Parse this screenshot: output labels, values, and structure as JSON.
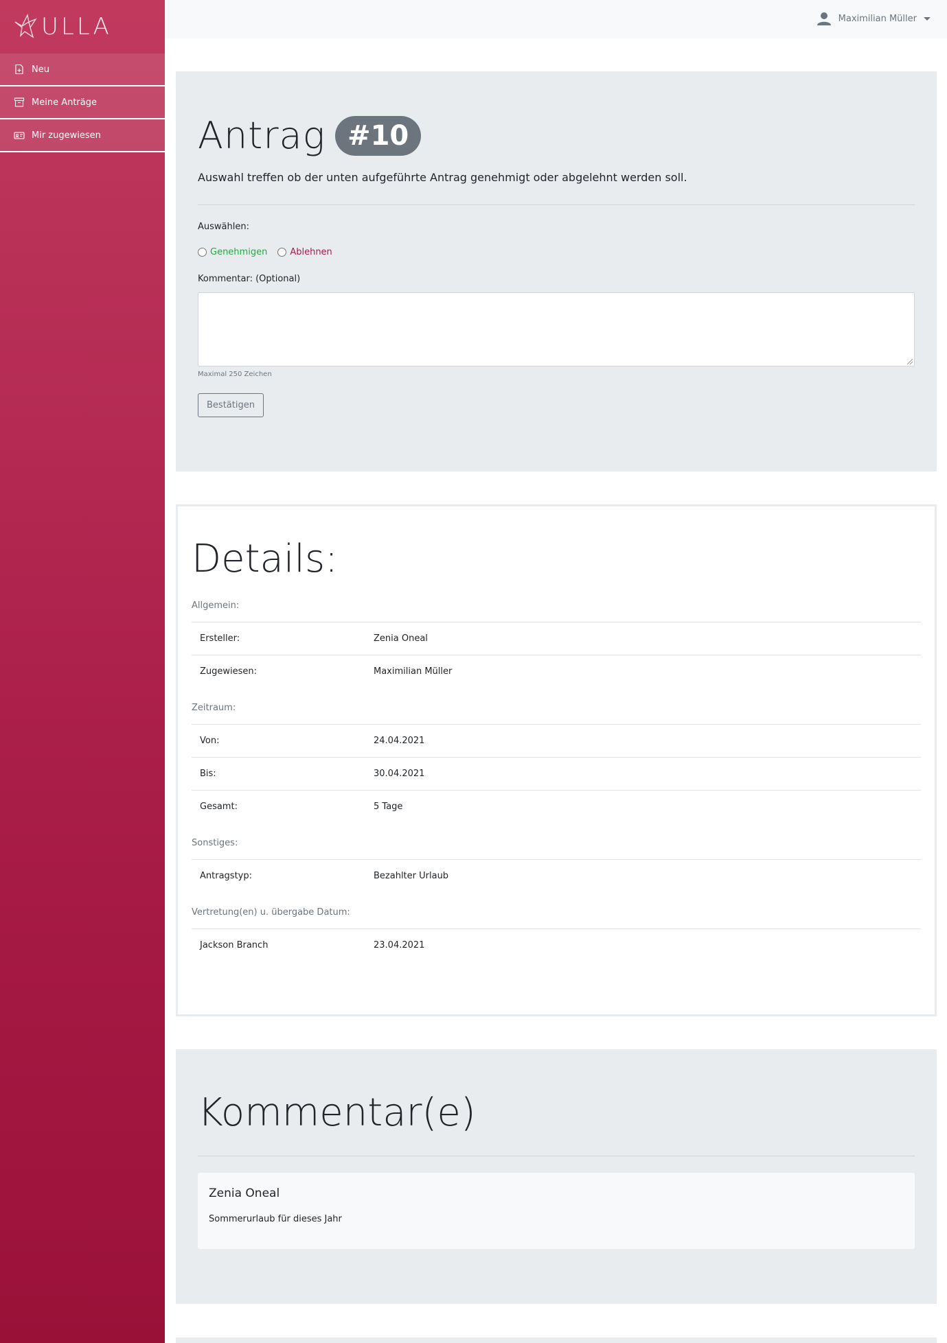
{
  "app": {
    "logo_text": "ULLA"
  },
  "sidebar": {
    "items": [
      {
        "label": "Neu",
        "icon": "file-plus-icon"
      },
      {
        "label": "Meine Anträge",
        "icon": "archive-icon"
      },
      {
        "label": "Mir zugewiesen",
        "icon": "id-card-icon"
      }
    ]
  },
  "topbar": {
    "user_name": "Maximilian Müller"
  },
  "request": {
    "title": "Antrag",
    "number": "#10",
    "lead": "Auswahl treffen ob der unten aufgeführte Antrag genehmigt oder abgelehnt werden soll.",
    "select_label": "Auswählen:",
    "approve_label": "Genehmigen",
    "reject_label": "Ablehnen",
    "comment_label": "Kommentar: (Optional)",
    "comment_value": "",
    "comment_hint": "Maximal 250 Zeichen",
    "submit_label": "Bestätigen"
  },
  "details": {
    "title": "Details:",
    "sections": [
      {
        "label": "Allgemein:",
        "rows": [
          {
            "key": "Ersteller:",
            "value": "Zenia Oneal"
          },
          {
            "key": "Zugewiesen:",
            "value": "Maximilian Müller"
          }
        ]
      },
      {
        "label": "Zeitraum:",
        "rows": [
          {
            "key": "Von:",
            "value": "24.04.2021"
          },
          {
            "key": "Bis:",
            "value": "30.04.2021"
          },
          {
            "key": "Gesamt:",
            "value": "5 Tage"
          }
        ]
      },
      {
        "label": "Sonstiges:",
        "rows": [
          {
            "key": "Antragstyp:",
            "value": "Bezahlter Urlaub"
          }
        ]
      },
      {
        "label": "Vertretung(en) u. übergabe Datum:",
        "rows": [
          {
            "key": "Jackson Branch",
            "value": "23.04.2021"
          }
        ]
      }
    ]
  },
  "comments": {
    "title": "Kommentar(e)",
    "items": [
      {
        "author": "Zenia Oneal",
        "text": "Sommerurlaub für dieses Jahr"
      }
    ]
  },
  "colors": {
    "sidebar_top": "#c13a5e",
    "sidebar_bottom": "#9a1138",
    "approve": "#28a745",
    "reject": "#b0184a",
    "badge": "#6c757d"
  }
}
